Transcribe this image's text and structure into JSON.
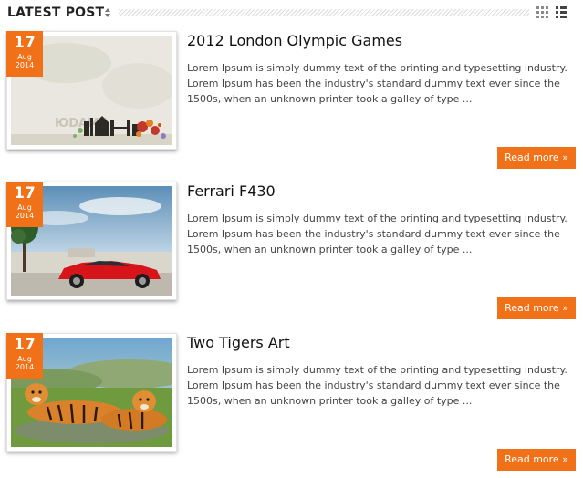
{
  "header": {
    "title": "LATEST POST",
    "sort_icon": "sort-arrows-icon",
    "view_icons": [
      "grid-view-icon",
      "list-view-icon"
    ]
  },
  "colors": {
    "accent": "#f07117",
    "title_text": "#111111",
    "body_text": "#444444"
  },
  "posts": [
    {
      "day": "17",
      "month": "Aug",
      "year": "2014",
      "title": "2012 London Olympic Games",
      "excerpt": "Lorem Ipsum is simply dummy text of the printing and typesetting industry. Lorem Ipsum has been the industry's standard dummy text ever since the 1500s, when an unknown printer took a galley of type ...",
      "read_more": "Read more »",
      "image": "london-skyline-artwork"
    },
    {
      "day": "17",
      "month": "Aug",
      "year": "2014",
      "title": "Ferrari F430",
      "excerpt": "Lorem Ipsum is simply dummy text of the printing and typesetting industry. Lorem Ipsum has been the industry's standard dummy text ever since the 1500s, when an unknown printer took a galley of type ...",
      "read_more": "Read more »",
      "image": "red-ferrari-car"
    },
    {
      "day": "17",
      "month": "Aug",
      "year": "2014",
      "title": "Two Tigers Art",
      "excerpt": "Lorem Ipsum is simply dummy text of the printing and typesetting industry. Lorem Ipsum has been the industry's standard dummy text ever since the 1500s, when an unknown printer took a galley of type ...",
      "read_more": "Read more »",
      "image": "two-tigers-painting"
    }
  ]
}
